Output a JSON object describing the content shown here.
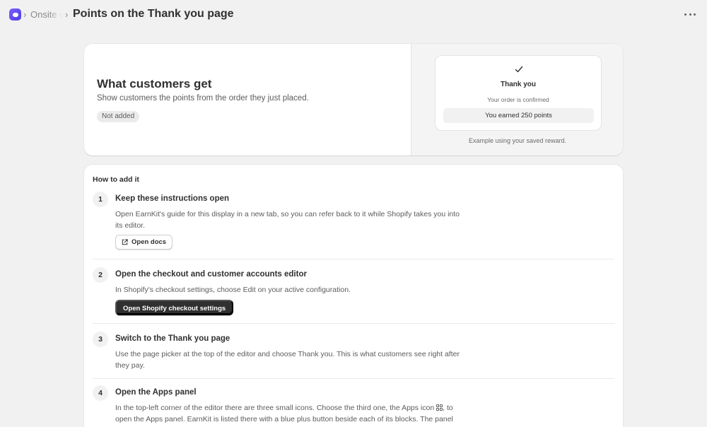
{
  "header": {
    "breadcrumb": "Onsite d",
    "page_title": "Points on the Thank you page"
  },
  "summary": {
    "title": "What customers get",
    "description": "Show customers the points from the order they just placed.",
    "status_badge": "Not added"
  },
  "preview": {
    "title": "Thank you",
    "subtitle": "Your order is confirmed",
    "points_line": "You earned 250 points",
    "caption": "Example using your saved reward."
  },
  "instructions": {
    "heading": "How to add it",
    "steps": [
      {
        "number": "1",
        "title": "Keep these instructions open",
        "description": "Open EarnKit's guide for this display in a new tab, so you can refer back to it while Shopify takes you into its editor.",
        "button": "Open docs"
      },
      {
        "number": "2",
        "title": "Open the checkout and customer accounts editor",
        "description": "In Shopify's checkout settings, choose Edit on your active configuration.",
        "button": "Open Shopify checkout settings"
      },
      {
        "number": "3",
        "title": "Switch to the Thank you page",
        "description": "Use the page picker at the top of the editor and choose Thank you. This is what customers see right after they pay."
      },
      {
        "number": "4",
        "title": "Open the Apps panel",
        "description_before": "In the top-left corner of the editor there are three small icons. Choose the third one, the Apps icon",
        "description_after": ", to open the Apps panel. EarnKit is listed there with a blue plus button beside each of its blocks. The panel"
      }
    ]
  },
  "colors": {
    "accent": "#6a4cf5",
    "primary_button": "#303030",
    "background": "#f1f1f1"
  }
}
